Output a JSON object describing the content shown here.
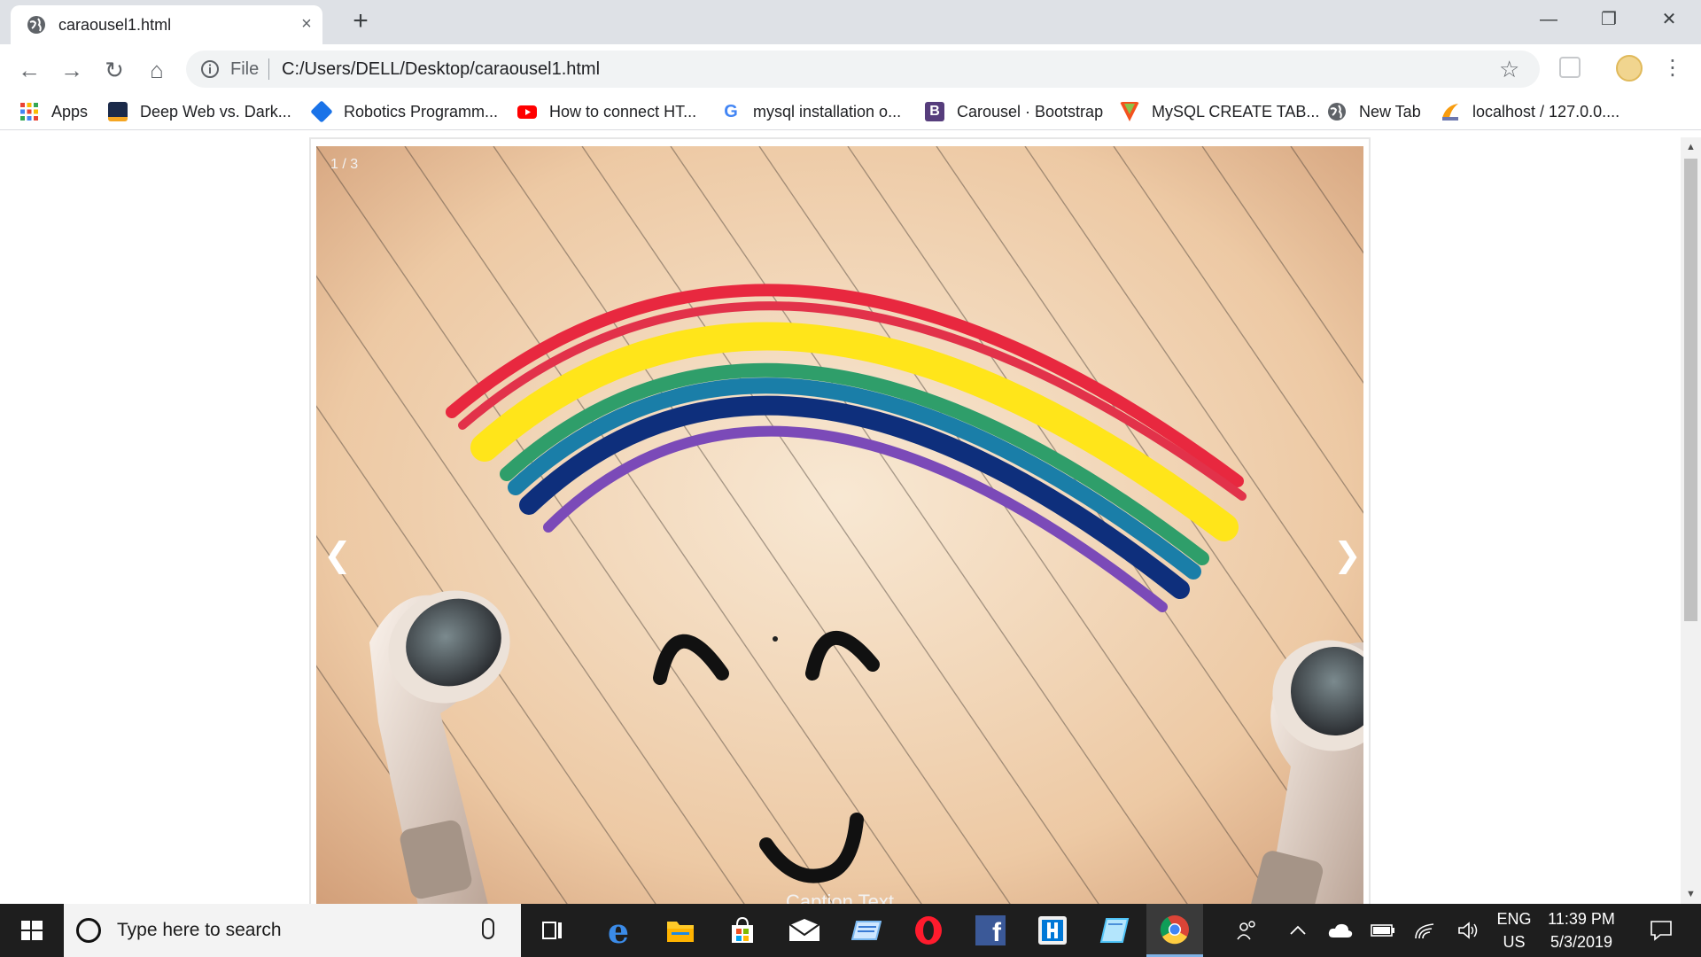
{
  "browser": {
    "tab": {
      "title": "caraousel1.html",
      "favicon": "globe-icon",
      "close": "×"
    },
    "new_tab": "+",
    "window_controls": {
      "minimize": "—",
      "restore": "❐",
      "close": "✕"
    }
  },
  "toolbar": {
    "back": "←",
    "forward": "→",
    "reload": "↻",
    "home": "⌂",
    "omnibox": {
      "scheme_label": "File",
      "url": "C:/Users/DELL/Desktop/caraousel1.html"
    },
    "bookmark_star": "☆",
    "menu": "⋮"
  },
  "bookmarks": [
    {
      "label": "Apps",
      "icon": "apps-grid-icon",
      "color": "#ea4335"
    },
    {
      "label": "Deep Web vs. Dark...",
      "icon": "deep-web-icon",
      "color": "#f5a623"
    },
    {
      "label": "Robotics Programm...",
      "icon": "robotics-icon",
      "color": "#1a73e8"
    },
    {
      "label": "How to connect HT...",
      "icon": "youtube-icon",
      "color": "#ff0000"
    },
    {
      "label": "mysql installation o...",
      "icon": "google-icon",
      "color": "#4285f4"
    },
    {
      "label": "Carousel · Bootstrap",
      "icon": "bootstrap-icon",
      "color": "#563d7c"
    },
    {
      "label": "MySQL CREATE TAB...",
      "icon": "w3-icon",
      "color": "#f4511e"
    },
    {
      "label": "New Tab",
      "icon": "globe-icon",
      "color": "#5f6368"
    },
    {
      "label": "localhost / 127.0.0....",
      "icon": "phpmyadmin-icon",
      "color": "#f89c0e"
    }
  ],
  "page": {
    "slideshow": {
      "number_text": "1 / 3",
      "prev": "❮",
      "next": "❯",
      "caption": "Caption Text"
    }
  },
  "taskbar": {
    "search_placeholder": "Type here to search",
    "apps": [
      {
        "name": "task-view",
        "glyph": "⧉"
      },
      {
        "name": "edge",
        "glyph": "e"
      },
      {
        "name": "file-explorer",
        "glyph": "▭"
      },
      {
        "name": "store",
        "glyph": "⊞"
      },
      {
        "name": "mail",
        "glyph": "✉"
      },
      {
        "name": "windows-app",
        "glyph": "▱"
      },
      {
        "name": "opera",
        "glyph": "O"
      },
      {
        "name": "facebook",
        "glyph": "f"
      },
      {
        "name": "sublime",
        "glyph": "◫"
      },
      {
        "name": "notes",
        "glyph": "◆"
      },
      {
        "name": "chrome",
        "glyph": "◉"
      }
    ],
    "tray": {
      "language_top": "ENG",
      "language_bottom": "US",
      "time": "11:39 PM",
      "date": "5/3/2019"
    }
  },
  "colors": {
    "tabstrip": "#dee1e6",
    "omnibox": "#f1f3f4",
    "taskbar": "#1e1e1e",
    "accent": "#1a73e8"
  }
}
